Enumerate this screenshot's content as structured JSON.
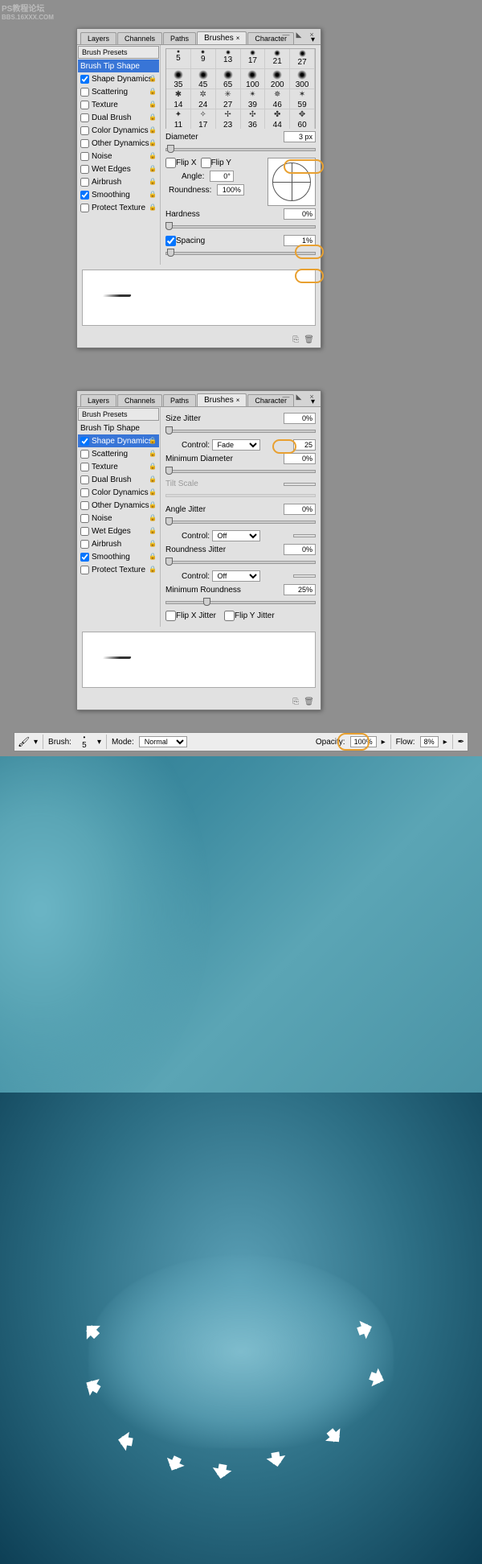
{
  "watermark": {
    "title": "PS教程论坛",
    "sub": "BBS.16XXX.COM"
  },
  "tabs": [
    "Layers",
    "Channels",
    "Paths",
    "Brushes",
    "Character"
  ],
  "activeTab": "Brushes",
  "winBtns": {
    "min": "—",
    "dock": "◣",
    "close": "×",
    "menu": "▾"
  },
  "options": {
    "presets": "Brush Presets",
    "tipShape": "Brush Tip Shape",
    "items": [
      "Shape Dynamics",
      "Scattering",
      "Texture",
      "Dual Brush",
      "Color Dynamics",
      "Other Dynamics",
      "Noise",
      "Wet Edges",
      "Airbrush",
      "Smoothing",
      "Protect Texture"
    ],
    "checked1": {
      "Shape Dynamics": true,
      "Smoothing": true
    },
    "checked2": {
      "Shape Dynamics": true,
      "Smoothing": true
    }
  },
  "brushSizes": [
    5,
    9,
    13,
    17,
    21,
    27,
    35,
    45,
    65,
    100,
    200,
    300,
    14,
    24,
    27,
    39,
    46,
    59,
    11,
    17,
    23,
    36,
    44,
    60
  ],
  "panel1": {
    "diameter": {
      "label": "Diameter",
      "value": "3 px"
    },
    "flipX": "Flip X",
    "flipY": "Flip Y",
    "angle": {
      "label": "Angle:",
      "value": "0°"
    },
    "round": {
      "label": "Roundness:",
      "value": "100%"
    },
    "hardness": {
      "label": "Hardness",
      "value": "0%"
    },
    "spacing": {
      "label": "Spacing",
      "value": "1%"
    }
  },
  "panel2": {
    "sizeJitter": {
      "label": "Size Jitter",
      "value": "0%"
    },
    "control1": {
      "label": "Control:",
      "value": "Fade",
      "num": "25"
    },
    "minDiam": {
      "label": "Minimum Diameter",
      "value": "0%"
    },
    "tiltScale": "Tilt Scale",
    "angleJitter": {
      "label": "Angle Jitter",
      "value": "0%"
    },
    "control2": {
      "label": "Control:",
      "value": "Off"
    },
    "roundJitter": {
      "label": "Roundness Jitter",
      "value": "0%"
    },
    "control3": {
      "label": "Control:",
      "value": "Off"
    },
    "minRound": {
      "label": "Minimum Roundness",
      "value": "25%"
    },
    "flipXJ": "Flip X Jitter",
    "flipYJ": "Flip Y Jitter"
  },
  "bar": {
    "brush": "Brush:",
    "brushSize": "5",
    "mode": "Mode:",
    "modeVal": "Normal",
    "opacity": "Opacity:",
    "opacityVal": "100%",
    "flow": "Flow:",
    "flowVal": "8%"
  },
  "footerIcons": {
    "doc": "⎘",
    "trash": "🗑"
  }
}
